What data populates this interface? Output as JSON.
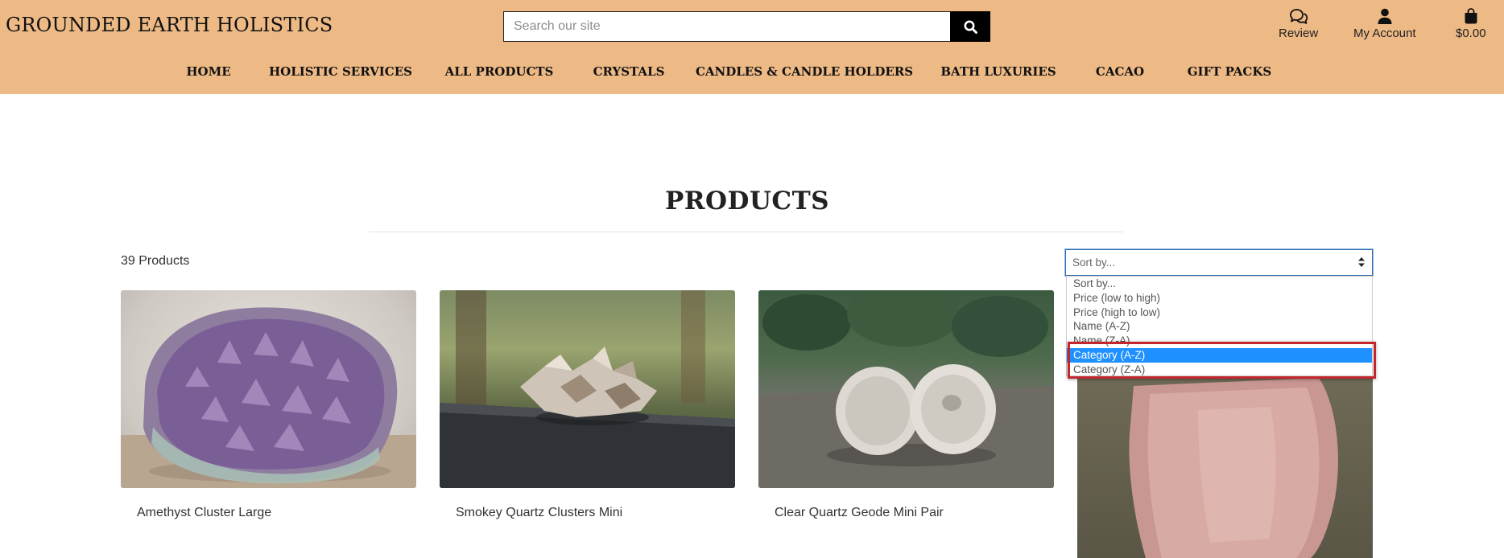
{
  "brand": "GROUNDED EARTH HOLISTICS",
  "search": {
    "placeholder": "Search our site"
  },
  "top_links": {
    "review": "Review",
    "account": "My Account",
    "bag": "$0.00"
  },
  "nav": [
    "HOME",
    "HOLISTIC SERVICES",
    "ALL PRODUCTS",
    "CRYSTALS",
    "CANDLES & CANDLE HOLDERS",
    "BATH LUXURIES",
    "CACAO",
    "GIFT PACKS"
  ],
  "page_title": "PRODUCTS",
  "product_count": "39 Products",
  "sort": {
    "current": "Sort by...",
    "options": [
      "Sort by...",
      "Price (low to high)",
      "Price (high to low)",
      "Name (A-Z)",
      "Name (Z-A)",
      "Category (A-Z)",
      "Category (Z-A)"
    ],
    "highlighted": "Category (A-Z)"
  },
  "products": [
    {
      "name": "Amethyst Cluster Large"
    },
    {
      "name": "Smokey Quartz Clusters Mini"
    },
    {
      "name": "Clear Quartz Geode Mini Pair"
    }
  ],
  "colors": {
    "header": "#edb985",
    "selected_option": "#1e90ff",
    "highlight_border": "#c1272d"
  },
  "icons": [
    "search-icon",
    "chat-bubbles-icon",
    "user-icon",
    "shopping-bag-icon",
    "sort-arrows-icon"
  ]
}
